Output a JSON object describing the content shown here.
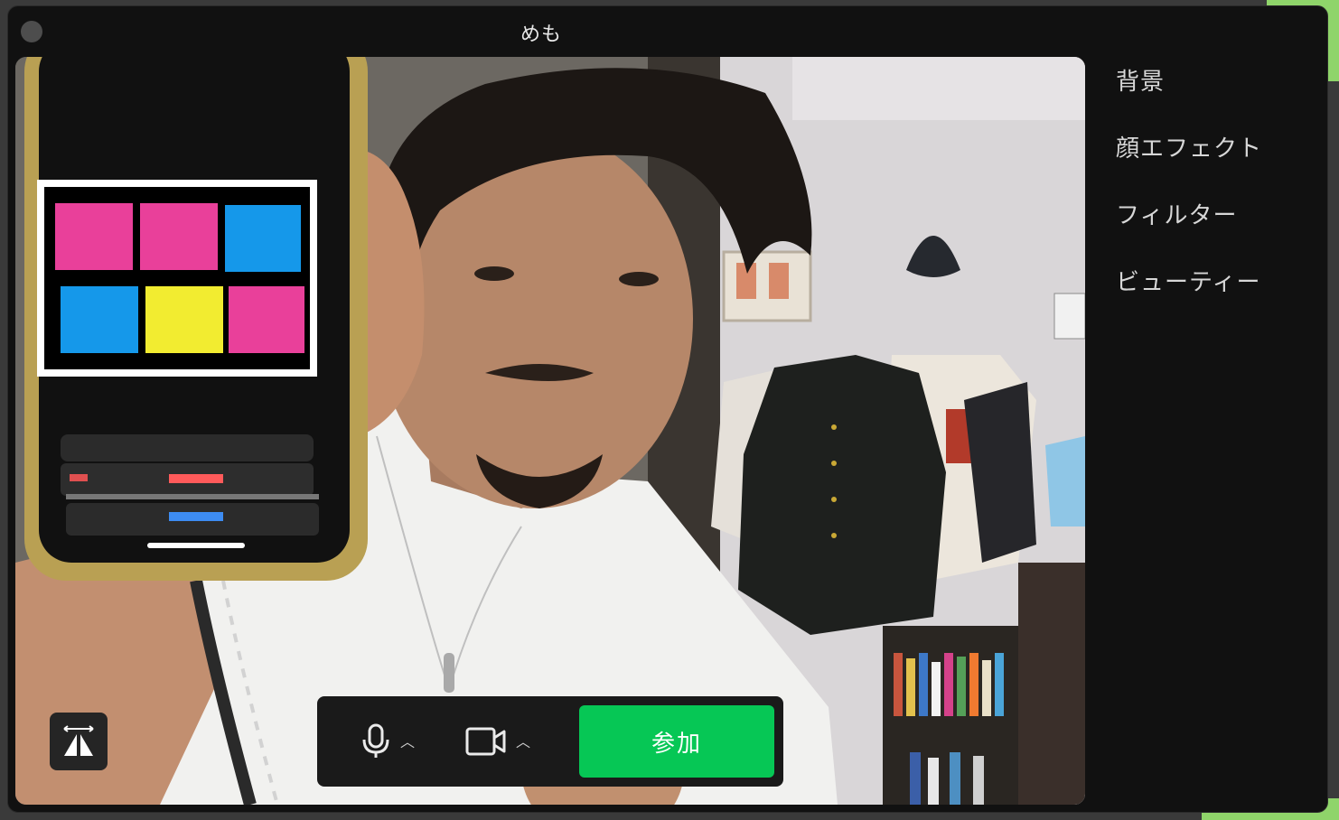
{
  "window": {
    "title": "めも"
  },
  "side_menu": {
    "items": [
      {
        "label": "背景"
      },
      {
        "label": "顔エフェクト"
      },
      {
        "label": "フィルター"
      },
      {
        "label": "ビューティー"
      }
    ]
  },
  "controls": {
    "mic_icon": "microphone-icon",
    "camera_icon": "video-camera-icon",
    "join_label": "参加"
  },
  "colors": {
    "accent": "#06c755",
    "window_bg": "#111111",
    "pink": "#e9409a",
    "blue": "#1598ea",
    "yellow": "#f2ec30"
  }
}
